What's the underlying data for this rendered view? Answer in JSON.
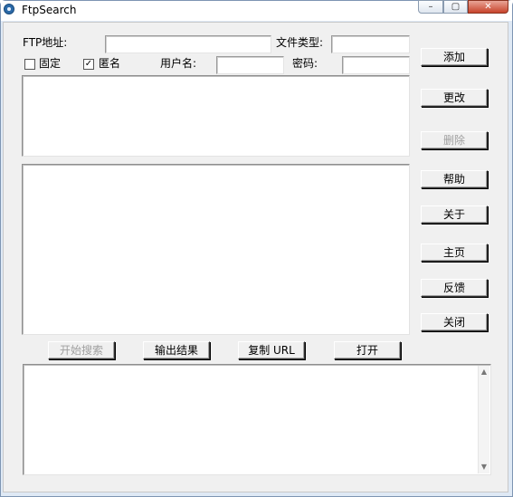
{
  "window": {
    "title": "FtpSearch"
  },
  "titlebar": {
    "min_glyph": "–",
    "max_glyph": "▢",
    "close_glyph": "✕"
  },
  "form": {
    "ftp_label": "FTP地址:",
    "ftp_value": "",
    "filetype_label": "文件类型:",
    "filetype_value": "",
    "fixed_label": "固定",
    "fixed_checked": false,
    "anon_label": "匿名",
    "anon_checked": true,
    "username_label": "用户名:",
    "username_value": "",
    "password_label": "密码:",
    "password_value": ""
  },
  "side_buttons": {
    "add": "添加",
    "modify": "更改",
    "delete": "删除",
    "help": "帮助",
    "about": "关于",
    "home": "主页",
    "feedback": "反馈",
    "close": "关闭"
  },
  "bottom_buttons": {
    "start": "开始搜索",
    "export": "输出结果",
    "copy_url": "复制 URL",
    "open": "打开"
  },
  "results": {
    "scroll_up": "▲",
    "scroll_down": "▼"
  },
  "glyphs": {
    "check": "✓"
  }
}
